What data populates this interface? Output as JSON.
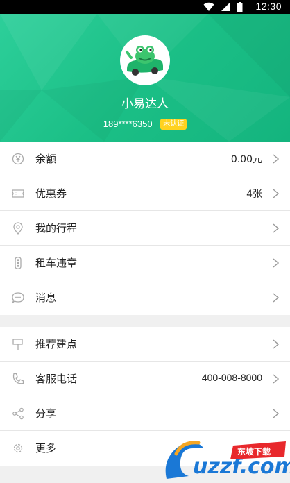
{
  "status_bar": {
    "time": "12:30"
  },
  "profile": {
    "name": "小易达人",
    "phone": "189****6350",
    "badge": "未认证"
  },
  "menu_group_1": [
    {
      "icon": "yen-coin-icon",
      "label": "余额",
      "value": "0.00元"
    },
    {
      "icon": "ticket-icon",
      "label": "优惠券",
      "value": "4张"
    },
    {
      "icon": "location-pin-icon",
      "label": "我的行程",
      "value": ""
    },
    {
      "icon": "traffic-light-icon",
      "label": "租车违章",
      "value": ""
    },
    {
      "icon": "chat-bubble-icon",
      "label": "消息",
      "value": ""
    }
  ],
  "menu_group_2": [
    {
      "icon": "signpost-icon",
      "label": "推荐建点",
      "value": ""
    },
    {
      "icon": "phone-icon",
      "label": "客服电话",
      "value": "400-008-8000"
    },
    {
      "icon": "share-icon",
      "label": "分享",
      "value": ""
    },
    {
      "icon": "gear-icon",
      "label": "更多",
      "value": ""
    }
  ],
  "watermark": {
    "brand": "uzzf.com",
    "tag": "东坡下载"
  }
}
